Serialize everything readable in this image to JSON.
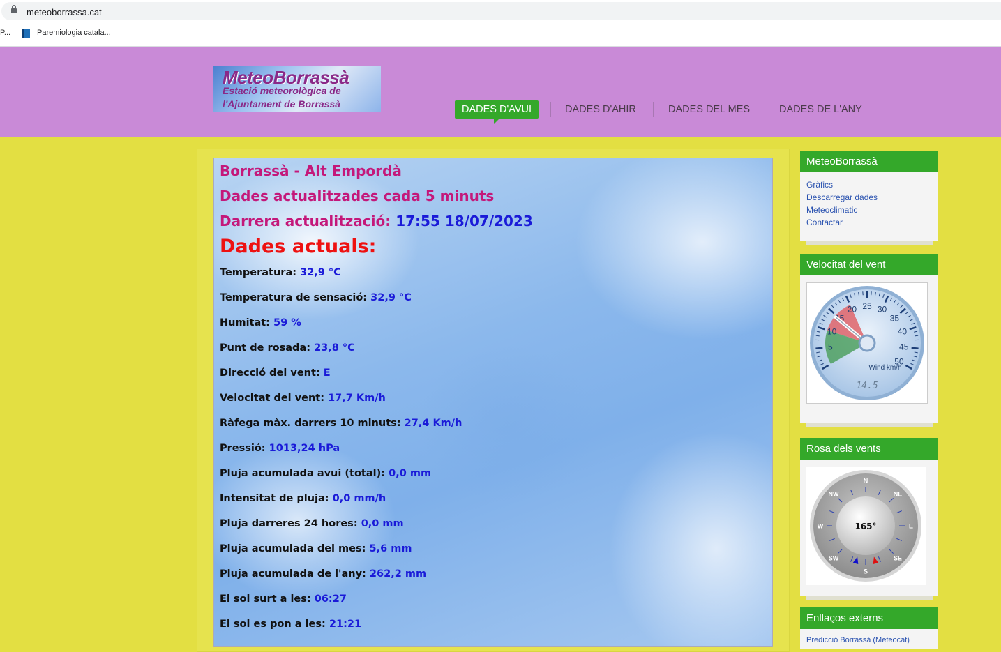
{
  "browser": {
    "url": "meteoborrassa.cat",
    "bookmarks_overflow": "P...",
    "bookmark_label": "Paremiologia catala..."
  },
  "header": {
    "logo": {
      "title": "MeteoBorrassà",
      "subtitle1": "Estació meteorològica de",
      "subtitle2": "l'Ajuntament de Borrassà"
    },
    "nav": [
      {
        "label": "DADES D'AVUI",
        "active": true
      },
      {
        "label": "DADES D'AHIR",
        "active": false
      },
      {
        "label": "DADES DEL MES",
        "active": false
      },
      {
        "label": "DADES DE L'ANY",
        "active": false
      }
    ]
  },
  "main": {
    "location": "Borrassà - Alt Empordà",
    "update_note": "Dades actualitzades cada 5 minuts",
    "last_update_label": "Darrera actualització:",
    "last_update_value": "17:55 18/07/2023",
    "current_heading": "Dades actuals:",
    "rows": [
      {
        "label": "Temperatura:",
        "value": "32,9 °C"
      },
      {
        "label": "Temperatura de sensació:",
        "value": "32,9 °C"
      },
      {
        "label": "Humitat:",
        "value": "59 %"
      },
      {
        "label": "Punt de rosada:",
        "value": "23,8 °C"
      },
      {
        "label": "Direcció del vent:",
        "value": "E"
      },
      {
        "label": "Velocitat del vent:",
        "value": "17,7 Km/h"
      },
      {
        "label": "Ràfega màx. darrers 10 minuts:",
        "value": "27,4 Km/h"
      },
      {
        "label": "Pressió:",
        "value": "1013,24 hPa"
      },
      {
        "label": "Pluja acumulada avui (total):",
        "value": "0,0 mm"
      },
      {
        "label": "Intensitat de pluja:",
        "value": "0,0 mm/h"
      },
      {
        "label": "Pluja darreres 24 hores:",
        "value": "0,0 mm"
      },
      {
        "label": "Pluja acumulada del mes:",
        "value": "5,6 mm"
      },
      {
        "label": "Pluja acumulada de l'any:",
        "value": "262,2 mm"
      },
      {
        "label": "El sol surt a les:",
        "value": "06:27"
      },
      {
        "label": "El sol es pon a les:",
        "value": "21:21"
      }
    ]
  },
  "sidebar": {
    "links_widget": {
      "title": "MeteoBorrassà",
      "links": [
        "Gràfics",
        "Descarregar dades",
        "Meteoclimatic",
        "Contactar"
      ]
    },
    "wind_widget": {
      "title": "Velocitat del vent",
      "gauge_label": "Wind km/h",
      "gauge_value": "14.5",
      "gauge_value_num": 14.5,
      "gauge_ticks": [
        "5",
        "10",
        "15",
        "20",
        "25",
        "30",
        "35",
        "40",
        "45",
        "50"
      ]
    },
    "rose_widget": {
      "title": "Rosa dels vents",
      "direction": "165°",
      "direction_deg": 165,
      "cardinals": [
        "N",
        "NE",
        "E",
        "SE",
        "S",
        "SW",
        "W",
        "NW"
      ]
    },
    "external_widget": {
      "title": "Enllaços externs",
      "link": "Predicció Borrassà (Meteocat)"
    }
  },
  "colors": {
    "header_bg": "#c98ad7",
    "page_bg": "#e3df42",
    "accent_green": "#34a82a",
    "heading_magenta": "#c4187a",
    "value_blue": "#1a1ad8",
    "alert_red": "#ee1111"
  }
}
